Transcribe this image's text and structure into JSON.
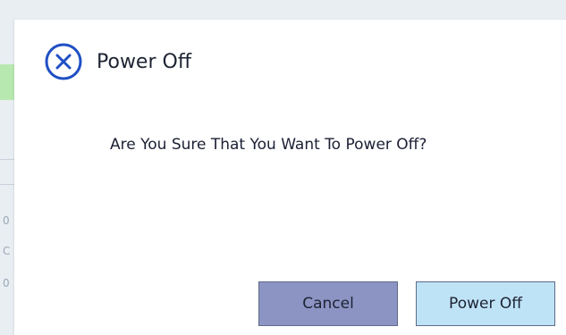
{
  "dialog": {
    "title": "Power Off",
    "message": "Are You Sure That You Want To Power Off?",
    "cancel_label": "Cancel",
    "confirm_label": "Power Off",
    "icon": "close-circle-icon"
  },
  "background": {
    "glyphs": [
      "0",
      "C",
      "0"
    ]
  },
  "colors": {
    "icon_blue": "#1f4fc4",
    "cancel_bg": "#8c94c4",
    "confirm_bg": "#bfe3f6",
    "title_text": "#1e2433"
  }
}
